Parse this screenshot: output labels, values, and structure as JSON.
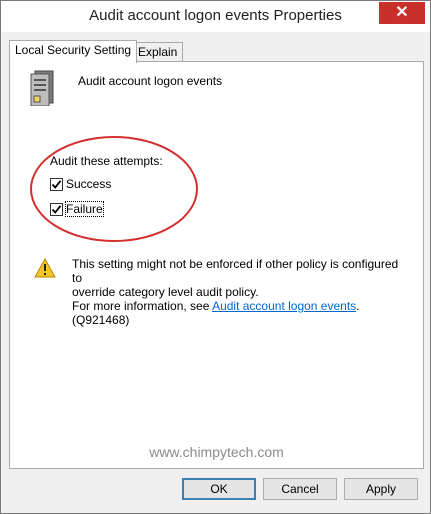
{
  "window": {
    "title": "Audit account logon events Properties",
    "close_label": "✕"
  },
  "tabs": [
    {
      "label": "Local Security Setting"
    },
    {
      "label": "Explain"
    }
  ],
  "policy": {
    "name": "Audit account logon events"
  },
  "audit": {
    "label": "Audit these attempts:",
    "success": {
      "label": "Success",
      "checked": true
    },
    "failure": {
      "label": "Failure",
      "checked": true
    }
  },
  "warning": {
    "line1": "This setting might not be enforced if other policy is configured to",
    "line2": "override category level audit policy.",
    "line3_prefix": "For more information, see ",
    "link": "Audit account logon events",
    "line3_suffix": ". (Q921468)"
  },
  "watermark": "www.chimpytech.com",
  "buttons": {
    "ok": "OK",
    "cancel": "Cancel",
    "apply": "Apply"
  },
  "colors": {
    "highlight_circle": "#d32f2f",
    "link": "#0066cc",
    "close_button": "#c9302c"
  }
}
